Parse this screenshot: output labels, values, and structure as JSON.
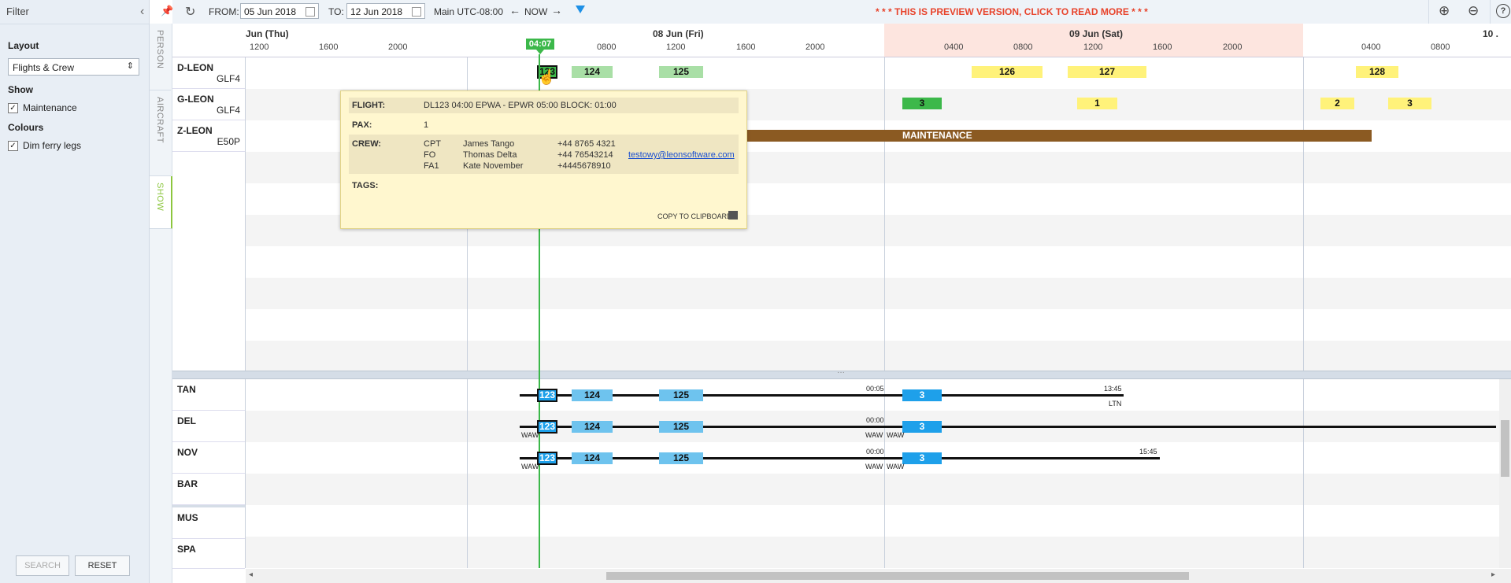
{
  "filter": {
    "title": "Filter",
    "layout_label": "Layout",
    "layout_value": "Flights & Crew",
    "show_label": "Show",
    "maintenance_label": "Maintenance",
    "colours_label": "Colours",
    "dim_ferry_label": "Dim ferry legs",
    "search_label": "SEARCH",
    "reset_label": "RESET"
  },
  "tabs": {
    "person": "PERSON",
    "aircraft": "AIRCRAFT",
    "show": "SHOW"
  },
  "toolbar": {
    "from_label": "FROM:",
    "from_value": "05 Jun 2018",
    "to_label": "TO:",
    "to_value": "12 Jun 2018",
    "timezone": "Main UTC-08:00",
    "now_label": "NOW",
    "preview_notice": "* * * THIS IS PREVIEW VERSION, CLICK TO READ MORE * * *"
  },
  "timeline": {
    "days": [
      "Jun (Thu)",
      "08 Jun (Fri)",
      "09 Jun (Sat)",
      "10 ."
    ],
    "hours": [
      "1200",
      "1600",
      "2000",
      "0800",
      "1200",
      "1600",
      "2000",
      "0400",
      "0800",
      "1200",
      "1600",
      "2000",
      "0400",
      "0800"
    ],
    "now_time": "04:07"
  },
  "aircraft": [
    {
      "reg": "D-LEON",
      "type": "GLF4"
    },
    {
      "reg": "G-LEON",
      "type": "GLF4"
    },
    {
      "reg": "Z-LEON",
      "type": "E50P"
    }
  ],
  "flights_top": {
    "dleon": [
      "123",
      "124",
      "125",
      "126",
      "127",
      "128"
    ],
    "gleon": [
      "3",
      "1",
      "2",
      "3"
    ],
    "maintenance": "MAINTENANCE"
  },
  "crew": {
    "names": [
      "TAN",
      "DEL",
      "NOV",
      "BAR",
      "MUS",
      "SPA"
    ],
    "flights": [
      "123",
      "124",
      "125",
      "3"
    ],
    "labels": {
      "tan_t1": "00:05",
      "tan_t2": "13:45",
      "tan_ltn": "LTN",
      "del_t1": "00:00",
      "del_waw1": "WAW",
      "del_waw2": "WAW",
      "del_waw3": "WAW",
      "nov_t1": "00:00",
      "nov_t2": "15:45",
      "nov_waw1": "WAW",
      "nov_waw2": "WAW",
      "nov_waw3": "WAW"
    }
  },
  "popup": {
    "flight_label": "FLIGHT:",
    "flight_value": "DL123 04:00 EPWA - EPWR 05:00 BLOCK: 01:00",
    "pax_label": "PAX:",
    "pax_value": "1",
    "crew_label": "CREW:",
    "crew": [
      {
        "role": "CPT",
        "name": "James Tango",
        "phone": "+44 8765 4321",
        "email": ""
      },
      {
        "role": "FO",
        "name": "Thomas Delta",
        "phone": "+44 76543214",
        "email": "testowy@leonsoftware.com"
      },
      {
        "role": "FA1",
        "name": "Kate November",
        "phone": "+4445678910",
        "email": ""
      }
    ],
    "tags_label": "TAGS:",
    "copy_label": "COPY TO CLIPBOARD"
  }
}
